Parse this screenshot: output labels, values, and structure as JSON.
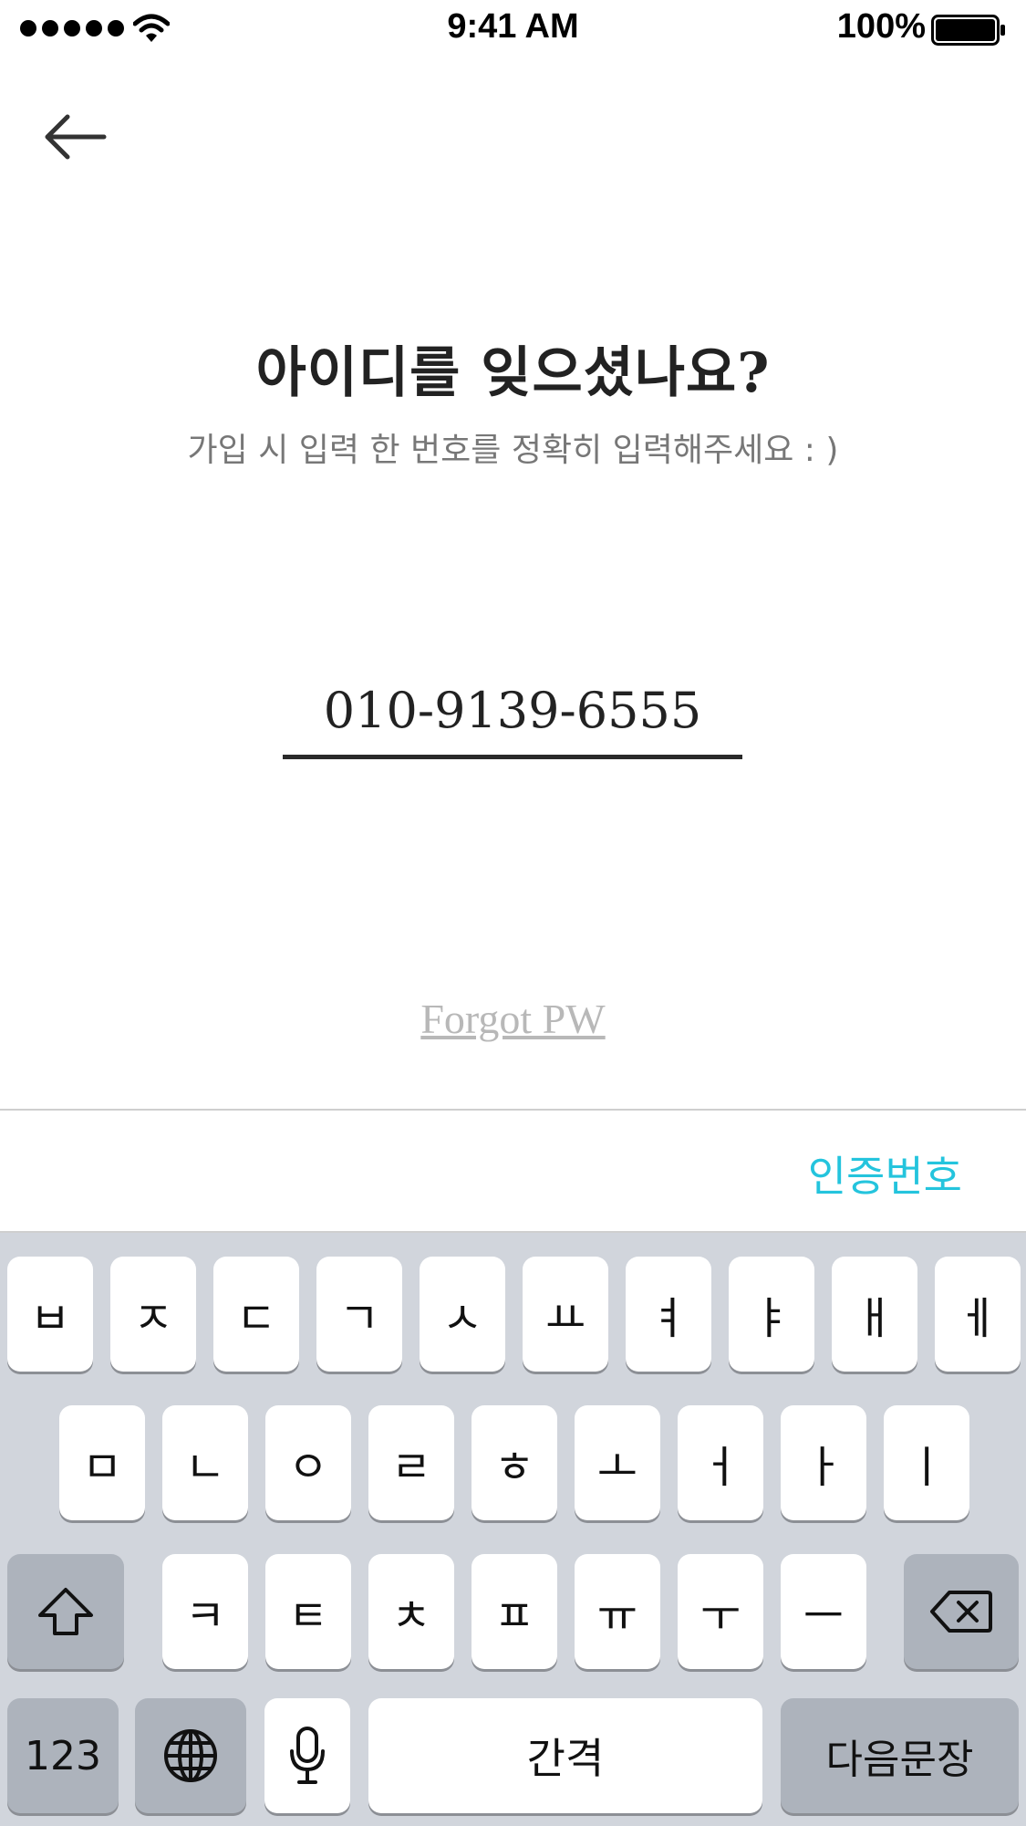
{
  "status_bar": {
    "time": "9:41 AM",
    "battery": "100%"
  },
  "header": {
    "back_icon": "arrow-left-icon"
  },
  "main": {
    "title": "아이디를 잊으셨나요?",
    "subtitle": "가입 시 입력 한 번호를 정확히 입력해주세요 : )",
    "phone_value": "010-9139-6555",
    "forgot_pw": "Forgot PW"
  },
  "accessory": {
    "verify_label": "인증번호",
    "verify_color": "#24c4dd"
  },
  "keyboard": {
    "row1": [
      "ㅂ",
      "ㅈ",
      "ㄷ",
      "ㄱ",
      "ㅅ",
      "ㅛ",
      "ㅕ",
      "ㅑ",
      "ㅐ",
      "ㅔ"
    ],
    "row2": [
      "ㅁ",
      "ㄴ",
      "ㅇ",
      "ㄹ",
      "ㅎ",
      "ㅗ",
      "ㅓ",
      "ㅏ",
      "ㅣ"
    ],
    "row3": [
      "ㅋ",
      "ㅌ",
      "ㅊ",
      "ㅍ",
      "ㅠ",
      "ㅜ",
      "ㅡ"
    ],
    "numbers_label": "123",
    "space_label": "간격",
    "return_label": "다음문장",
    "icons": {
      "shift": "shift-icon",
      "backspace": "backspace-icon",
      "globe": "globe-icon",
      "mic": "microphone-icon"
    }
  }
}
